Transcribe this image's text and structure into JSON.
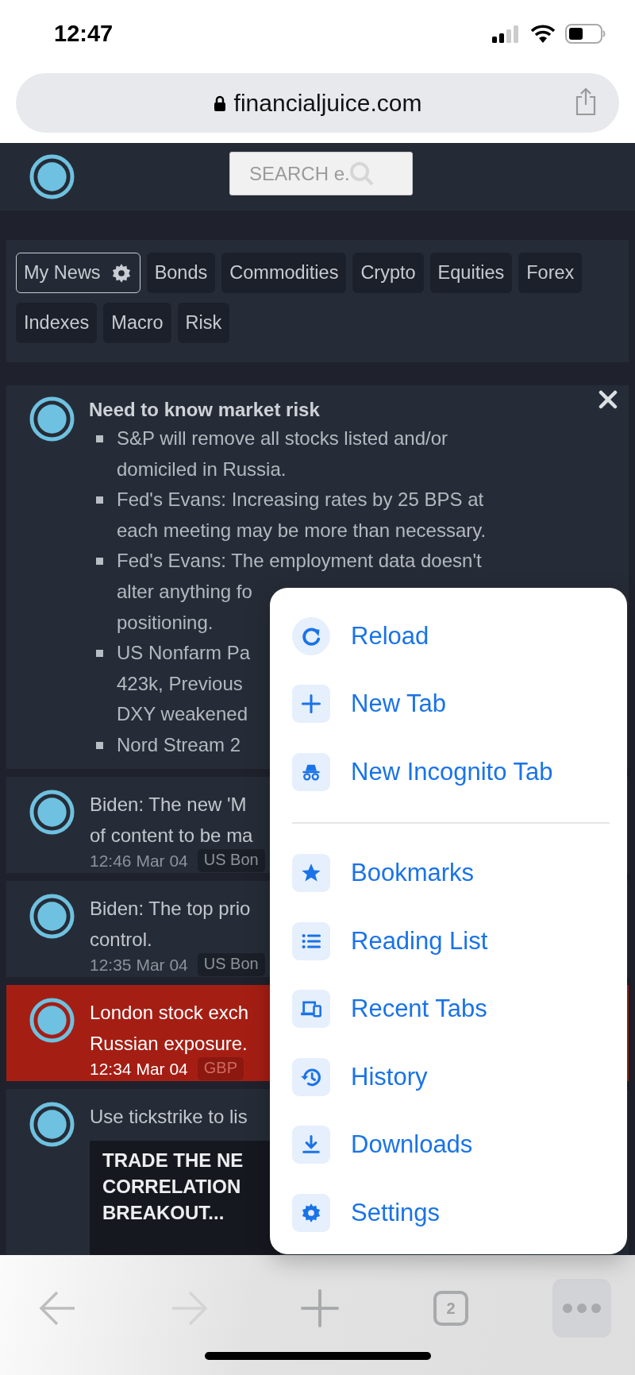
{
  "status_bar": {
    "time": "12:47"
  },
  "address_bar": {
    "url": "financialjuice.com"
  },
  "site_header": {
    "search": {
      "placeholder": "SEARCH e."
    }
  },
  "filter_tags": [
    {
      "label": "My News",
      "kind": "custom",
      "selected": true
    },
    {
      "label": "Bonds",
      "kind": "topic",
      "selected": false
    },
    {
      "label": "Commodities",
      "kind": "topic",
      "selected": false
    },
    {
      "label": "Crypto",
      "kind": "topic",
      "selected": false
    },
    {
      "label": "Equities",
      "kind": "topic",
      "selected": false
    },
    {
      "label": "Forex",
      "kind": "topic",
      "selected": false
    },
    {
      "label": "Indexes",
      "kind": "topic",
      "selected": false
    },
    {
      "label": "Macro",
      "kind": "topic",
      "selected": false
    },
    {
      "label": "Risk",
      "kind": "topic",
      "selected": false
    }
  ],
  "risk_card": {
    "title": "Need to know market risk",
    "bullets": [
      {
        "lines": [
          "S&P will remove all stocks listed and/or",
          "domiciled in Russia."
        ]
      },
      {
        "lines": [
          "Fed's Evans: Increasing rates by 25 BPS at",
          "each meeting may be more than necessary."
        ]
      },
      {
        "lines": [
          "Fed's Evans: The employment data doesn't",
          "alter anything fo",
          "positioning."
        ]
      },
      {
        "lines": [
          "US Nonfarm Pa",
          "423k, Previous",
          "DXY weakened"
        ]
      },
      {
        "lines": [
          "Nord Stream 2"
        ]
      }
    ]
  },
  "news": [
    {
      "kind": "headline",
      "highlighted": false,
      "lines": [
        "Biden: The new 'M",
        "of content to be ma"
      ],
      "time": "12:46 Mar 04",
      "tags": [
        "US Bon"
      ]
    },
    {
      "kind": "headline",
      "highlighted": false,
      "lines": [
        "Biden: The top prio",
        "control."
      ],
      "time": "12:35 Mar 04",
      "tags": [
        "US Bon"
      ]
    },
    {
      "kind": "headline",
      "highlighted": true,
      "lines": [
        "London stock exch",
        "Russian exposure."
      ],
      "time": "12:34 Mar 04",
      "tags": [
        "GBP"
      ]
    },
    {
      "kind": "ad",
      "highlighted": false,
      "lines": [
        "Use tickstrike to lis"
      ],
      "banner": [
        "TRADE THE NE",
        "CORRELATION",
        "BREAKOUT..."
      ]
    }
  ],
  "menu": {
    "groups": [
      [
        {
          "label": "Reload"
        },
        {
          "label": "New Tab"
        },
        {
          "label": "New Incognito Tab"
        }
      ],
      [
        {
          "label": "Bookmarks"
        },
        {
          "label": "Reading List"
        },
        {
          "label": "Recent Tabs"
        },
        {
          "label": "History"
        },
        {
          "label": "Downloads"
        },
        {
          "label": "Settings"
        }
      ]
    ]
  },
  "toolbar": {
    "back": {
      "disabled": false
    },
    "forward": {
      "disabled": true
    },
    "tab_count": "2",
    "menu_open": true
  }
}
